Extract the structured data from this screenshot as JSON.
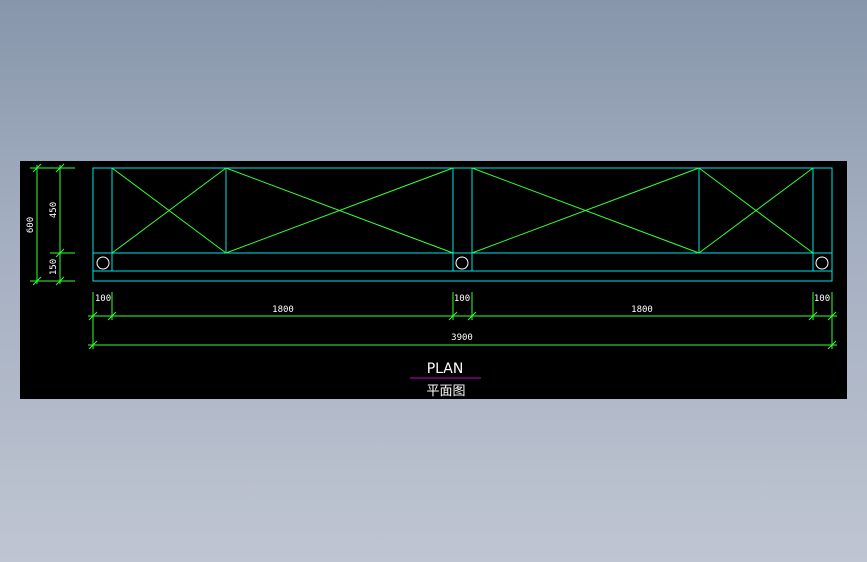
{
  "colors": {
    "background_top": "#8796ab",
    "background_bottom": "#bfc5d2",
    "canvas": "#000000",
    "frame": "#00e5e5",
    "bracing": "#33ff33",
    "dimension": "#33ff33",
    "text": "#ffffff",
    "title_underline": "#cc00cc"
  },
  "drawing": {
    "title": "PLAN",
    "subtitle": "平面图",
    "dimensions": {
      "vertical_total": "600",
      "vertical_upper": "450",
      "vertical_lower": "150",
      "post_left": "100",
      "span_left": "1800",
      "post_mid": "100",
      "span_right": "1800",
      "post_right": "100",
      "overall": "3900"
    }
  }
}
